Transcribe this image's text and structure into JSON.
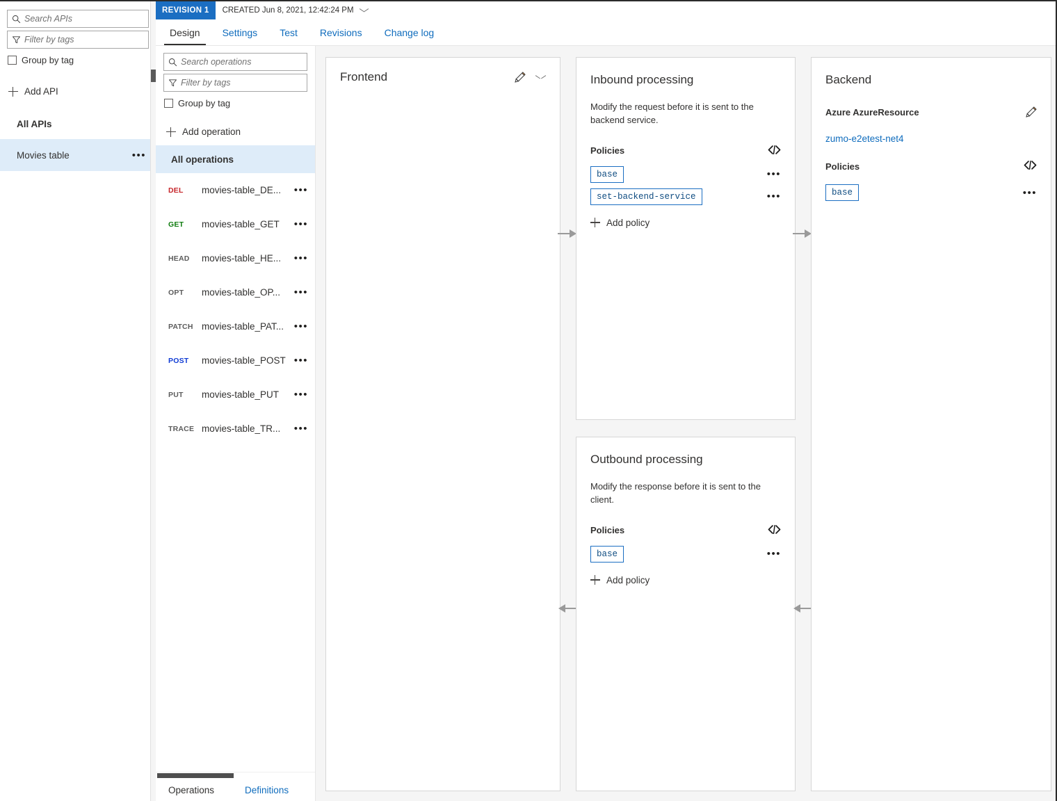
{
  "sidebar": {
    "search": {
      "placeholder": "Search APIs",
      "value": "",
      "icon": "search-icon"
    },
    "filter": {
      "placeholder": "Filter by tags",
      "value": "",
      "icon": "filter-icon"
    },
    "group_by_tag_label": "Group by tag",
    "add_api_label": "Add API",
    "all_apis_label": "All APIs",
    "apis": [
      {
        "name": "Movies table",
        "selected": true,
        "menu": "•••"
      }
    ]
  },
  "header": {
    "revision_badge": "REVISION 1",
    "created_text": "CREATED Jun 8, 2021, 12:42:24 PM",
    "chevron_icon": "chevron-down-icon",
    "tabs": [
      {
        "label": "Design",
        "active": true
      },
      {
        "label": "Settings",
        "active": false
      },
      {
        "label": "Test",
        "active": false
      },
      {
        "label": "Revisions",
        "active": false
      },
      {
        "label": "Change log",
        "active": false
      }
    ]
  },
  "operations_panel": {
    "search": {
      "placeholder": "Search operations",
      "value": "",
      "icon": "search-icon"
    },
    "filter": {
      "placeholder": "Filter by tags",
      "value": "",
      "icon": "filter-icon"
    },
    "group_by_tag_label": "Group by tag",
    "add_operation_label": "Add operation",
    "all_operations_label": "All operations",
    "operations": [
      {
        "verb": "DEL",
        "name": "movies-table_DE...",
        "color": "#c6252a",
        "menu": "•••"
      },
      {
        "verb": "GET",
        "name": "movies-table_GET",
        "color": "#107c10",
        "menu": "•••"
      },
      {
        "verb": "HEAD",
        "name": "movies-table_HE...",
        "color": "#5c5c5c",
        "menu": "•••"
      },
      {
        "verb": "OPT",
        "name": "movies-table_OP...",
        "color": "#5c5c5c",
        "menu": "•••"
      },
      {
        "verb": "PATCH",
        "name": "movies-table_PAT...",
        "color": "#5c5c5c",
        "menu": "•••"
      },
      {
        "verb": "POST",
        "name": "movies-table_POST",
        "color": "#0f3bd4",
        "menu": "•••"
      },
      {
        "verb": "PUT",
        "name": "movies-table_PUT",
        "color": "#5c5c5c",
        "menu": "•••"
      },
      {
        "verb": "TRACE",
        "name": "movies-table_TR...",
        "color": "#5c5c5c",
        "menu": "•••"
      }
    ],
    "bottom_tabs": [
      {
        "label": "Operations",
        "active": true
      },
      {
        "label": "Definitions",
        "active": false
      }
    ]
  },
  "frontend": {
    "title": "Frontend",
    "edit_icon": "pencil-icon",
    "expand_icon": "chevron-down-icon"
  },
  "inbound": {
    "title": "Inbound processing",
    "description": "Modify the request before it is sent to the backend service.",
    "policies_label": "Policies",
    "code_icon": "code-view-icon",
    "policies": [
      {
        "name": "base",
        "menu": "•••"
      },
      {
        "name": "set-backend-service",
        "menu": "•••"
      }
    ],
    "add_policy_label": "Add policy"
  },
  "outbound": {
    "title": "Outbound processing",
    "description": "Modify the response before it is sent to the client.",
    "policies_label": "Policies",
    "code_icon": "code-view-icon",
    "policies": [
      {
        "name": "base",
        "menu": "•••"
      }
    ],
    "add_policy_label": "Add policy"
  },
  "backend": {
    "title": "Backend",
    "resource_label": "Azure AzureResource",
    "edit_icon": "pencil-icon",
    "resource_link": "zumo-e2etest-net4",
    "policies_label": "Policies",
    "code_icon": "code-view-icon",
    "policies": [
      {
        "name": "base",
        "menu": "•••"
      }
    ]
  },
  "colors": {
    "accent": "#0f6cbd",
    "revision_badge_bg": "#1b6ec2",
    "selection_bg": "#deecf9",
    "canvas_bg": "#f5f5f5",
    "panel_border": "#d6d6d6",
    "chip_border": "#1b6ec2"
  }
}
